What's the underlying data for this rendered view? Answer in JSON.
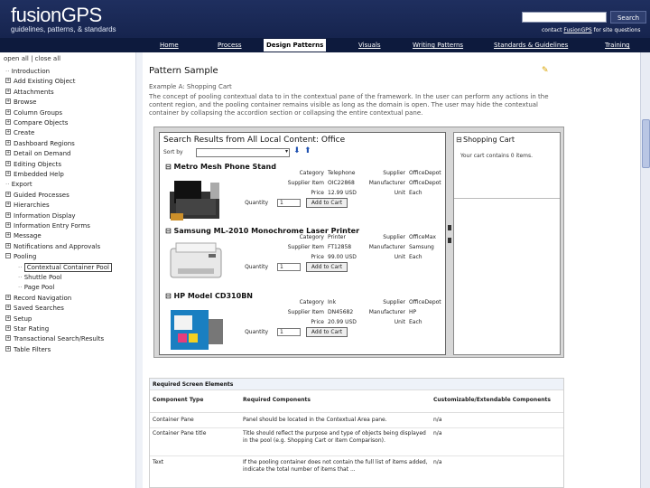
{
  "header": {
    "logo": "fusionGPS",
    "tagline": "guidelines, patterns, & standards",
    "search_button": "Search",
    "contact_prefix": "contact",
    "contact_link": "FusionGPS",
    "contact_suffix": "for site questions"
  },
  "nav": {
    "items": [
      "Home",
      "Process",
      "Design Patterns",
      "Visuals",
      "Writing Patterns",
      "Standards & Guidelines",
      "Training"
    ],
    "active": "Design Patterns"
  },
  "sidebar": {
    "open_all": "open all | close all",
    "items": [
      "Introduction",
      "Add Existing Object",
      "Attachments",
      "Browse",
      "Column Groups",
      "Compare Objects",
      "Create",
      "Dashboard Regions",
      "Detail on Demand",
      "Editing Objects",
      "Embedded Help",
      "Export",
      "Guided Processes",
      "Hierarchies",
      "Information Display",
      "Information Entry Forms",
      "Message",
      "Notifications and Approvals",
      "Pooling",
      "Contextual Container Pool",
      "Shuttle Pool",
      "Page Pool",
      "Record Navigation",
      "Saved Searches",
      "Setup",
      "Star Rating",
      "Transactional Search/Results",
      "Table Filters"
    ],
    "selected": "Contextual Container Pool"
  },
  "main": {
    "title": "Pattern Sample",
    "example": "Example A: Shopping Cart",
    "description": "The concept of pooling contextual data to in the contextual pane of the framework. In the user can perform any actions in the content region, and the pooling container remains visible as long as the domain is open. The user may hide the contextual container by collapsing the accordion section or collapsing the entire contextual pane."
  },
  "prototype": {
    "results_title": "Search Results from All Local Content: Office",
    "sort_label": "Sort by",
    "sort_value": "",
    "labels": {
      "category": "Category",
      "supplier_item": "Supplier Item",
      "price": "Price",
      "quantity": "Quantity",
      "supplier": "Supplier",
      "manufacturer": "Manufacturer",
      "unit": "Unit",
      "add_to_cart": "Add to Cart"
    },
    "products": [
      {
        "name": "Metro Mesh Phone Stand",
        "category": "Telephone",
        "item": "OIC22868",
        "price": "12.99 USD",
        "qty": "1",
        "supplier": "OfficeDepot",
        "manufacturer": "OfficeDepot",
        "unit": "Each"
      },
      {
        "name": "Samsung ML-2010 Monochrome Laser Printer",
        "category": "Printer",
        "item": "FT12858",
        "price": "99.00 USD",
        "qty": "1",
        "supplier": "OfficeMax",
        "manufacturer": "Samsung",
        "unit": "Each"
      },
      {
        "name": "HP Model CD310BN",
        "category": "Ink",
        "item": "DN45682",
        "price": "20.99 USD",
        "qty": "1",
        "supplier": "OfficeDepot",
        "manufacturer": "HP",
        "unit": "Each"
      }
    ],
    "cart_title": "Shopping Cart",
    "cart_message": "Your cart contains 0 items."
  },
  "requirements": {
    "heading": "Required Screen Elements",
    "columns": [
      "Component Type",
      "Required Components",
      "Customizable/Extendable Components"
    ],
    "rows": [
      {
        "type": "Container Pane",
        "req": "Panel should be located in the Contextual Area pane.",
        "custom": "n/a"
      },
      {
        "type": "Container Pane title",
        "req": "Title should reflect the purpose and type of objects being displayed in the pool (e.g. Shopping Cart or Item Comparison).",
        "custom": "n/a"
      },
      {
        "type": "Text",
        "req": "If the pooling container does not contain the full list of items added, indicate the total number of items that ...",
        "custom": "n/a"
      }
    ]
  }
}
